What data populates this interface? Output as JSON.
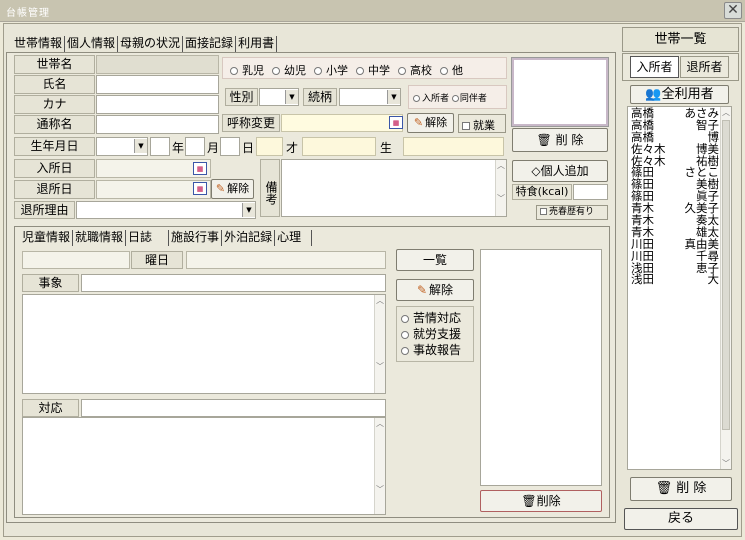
{
  "window": {
    "title": "台帳管理",
    "close": "✕"
  },
  "tabs": [
    "世帯情報",
    "個人情報",
    "母親の状況",
    "面接記録",
    "利用書"
  ],
  "form": {
    "setai_name": "世帯名",
    "shimei": "氏名",
    "kana": "カナ",
    "tsushomei": "通称名",
    "birth": "生年月日",
    "year": "年",
    "month": "月",
    "day": "日",
    "age": "才",
    "born": "生",
    "nyusho": "入所日",
    "taisho": "退所日",
    "taisho_reason": "退所理由",
    "seibetsu": "性別",
    "zokugara": "続柄",
    "kosho": "呼称変更",
    "kaijo": "解除",
    "shugyo": "就業",
    "biko": "備考"
  },
  "categories": [
    "乳児",
    "幼児",
    "小学",
    "中学",
    "高校",
    "他"
  ],
  "resident_type": [
    "入所者",
    "同伴者"
  ],
  "buttons": {
    "delete": "削 除",
    "add_person": "個人追加",
    "tokushoku": "特食(kcal)",
    "baishun": "売春歴有り",
    "all_users": "全利用者",
    "return": "戻る",
    "ichiran": "一覧",
    "kaijo": "解除",
    "delete2": "削除"
  },
  "subtabs": [
    "児童情報",
    "就職情報",
    "日誌",
    "施設行事",
    "外泊記録",
    "心理"
  ],
  "diary": {
    "youbi": "曜日",
    "jijou": "事象",
    "taiou": "対応",
    "options": [
      "苦情対応",
      "就労支援",
      "事故報告"
    ]
  },
  "sidebar": {
    "title": "世帯一覧",
    "tab_in": "入所者",
    "tab_out": "退所者",
    "residents": [
      {
        "last": "高橋",
        "first": "あさみ"
      },
      {
        "last": "高橋",
        "first": "智子"
      },
      {
        "last": "高橋",
        "first": "博"
      },
      {
        "last": "佐々木",
        "first": "博美"
      },
      {
        "last": "佐々木",
        "first": "祐樹"
      },
      {
        "last": "篠田",
        "first": "さとこ"
      },
      {
        "last": "篠田",
        "first": "美樹"
      },
      {
        "last": "篠田",
        "first": "眞子"
      },
      {
        "last": "青木",
        "first": "久美子"
      },
      {
        "last": "青木",
        "first": "奏太"
      },
      {
        "last": "青木",
        "first": "雄太"
      },
      {
        "last": "川田",
        "first": "真由美"
      },
      {
        "last": "川田",
        "first": "千尋"
      },
      {
        "last": "浅田",
        "first": "恵子"
      },
      {
        "last": "浅田",
        "first": "大"
      }
    ]
  }
}
